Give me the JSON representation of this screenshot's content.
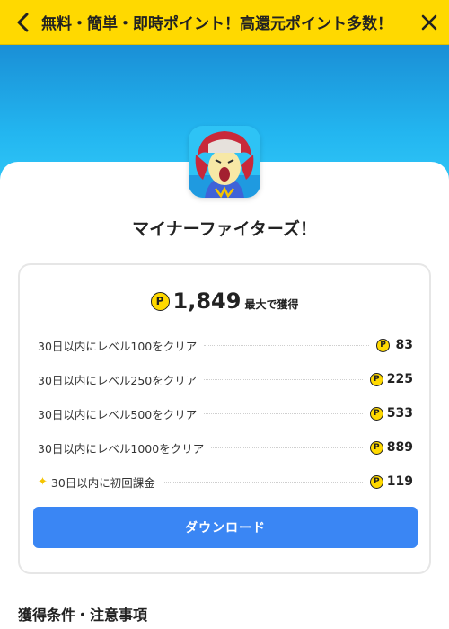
{
  "header": {
    "title": "無料・簡単・即時ポイント！高還元ポイント多数！",
    "back_icon": "chevron-left-icon",
    "close_icon": "close-icon",
    "background": "#ffd900"
  },
  "app": {
    "name": "マイナーファイターズ！",
    "icon": "game-character-icon"
  },
  "reward": {
    "max_points": "1,849",
    "max_suffix": "最大で獲得",
    "coin_symbol": "P",
    "items": [
      {
        "label": "30日以内にレベル100をクリア",
        "points": "83",
        "special": false
      },
      {
        "label": "30日以内にレベル250をクリア",
        "points": "225",
        "special": false
      },
      {
        "label": "30日以内にレベル500をクリア",
        "points": "533",
        "special": false
      },
      {
        "label": "30日以内にレベル1000をクリア",
        "points": "889",
        "special": false
      },
      {
        "label": "30日以内に初回課金",
        "points": "119",
        "special": true
      }
    ]
  },
  "download_button": {
    "label": "ダウンロード",
    "color": "#3a86f4"
  },
  "conditions": {
    "title": "獲得条件・注意事項"
  }
}
